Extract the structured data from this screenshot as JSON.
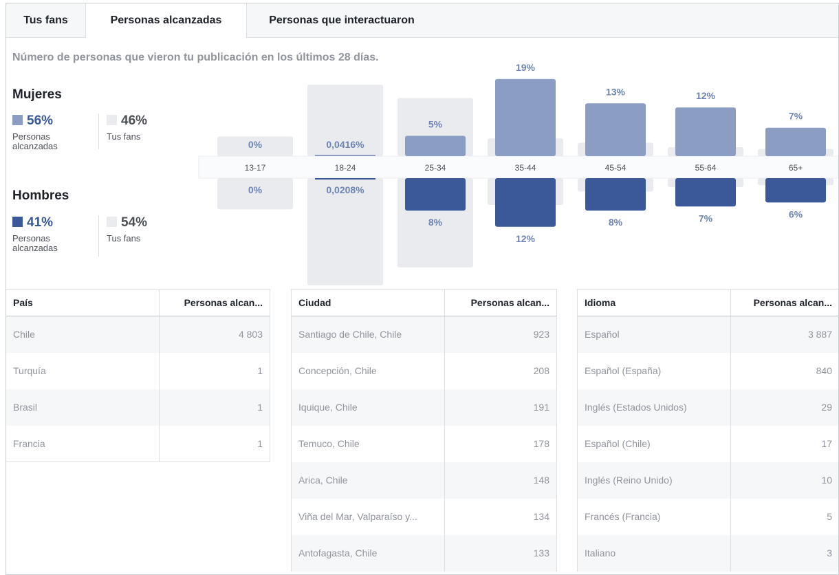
{
  "tabs": [
    "Tus fans",
    "Personas alcanzadas",
    "Personas que interactuaron"
  ],
  "subtitle": "Número de personas que vieron tu publicación en los últimos 28 días.",
  "women": {
    "title": "Mujeres",
    "reached_pct": "56%",
    "reached_label": "Personas alcanzadas",
    "fans_pct": "46%",
    "fans_label": "Tus fans"
  },
  "men": {
    "title": "Hombres",
    "reached_pct": "41%",
    "reached_label": "Personas alcanzadas",
    "fans_pct": "54%",
    "fans_label": "Tus fans"
  },
  "colors": {
    "women": "#8b9dc3",
    "men": "#3b5998",
    "fans": "#e9ebee",
    "axis_band": "#f6f7f9"
  },
  "chart_data": {
    "type": "bar",
    "categories": [
      "13-17",
      "18-24",
      "25-34",
      "35-44",
      "45-54",
      "55-64",
      "65+"
    ],
    "series": [
      {
        "name": "Mujeres",
        "values": [
          0,
          0.0416,
          5,
          19,
          13,
          12,
          7
        ],
        "labels": [
          "0%",
          "0,0416%",
          "5%",
          "19%",
          "13%",
          "12%",
          "7%"
        ]
      },
      {
        "name": "Hombres",
        "values": [
          0,
          0.0208,
          8,
          12,
          8,
          7,
          6
        ],
        "labels": [
          "0%",
          "0,0208%",
          "8%",
          "12%",
          "8%",
          "7%",
          "6%"
        ]
      }
    ],
    "fans_women": [
      2.2,
      8,
      6.5,
      2,
      1.5,
      1,
      0.8
    ],
    "fans_men": [
      3.5,
      12,
      10,
      3,
      1.5,
      1,
      0.8
    ]
  },
  "tables": [
    {
      "headers": [
        "País",
        "Personas alcan..."
      ],
      "rows": [
        [
          "Chile",
          "4 803"
        ],
        [
          "Turquía",
          "1"
        ],
        [
          "Brasil",
          "1"
        ],
        [
          "Francia",
          "1"
        ]
      ]
    },
    {
      "headers": [
        "Ciudad",
        "Personas alcan..."
      ],
      "rows": [
        [
          "Santiago de Chile, Chile",
          "923"
        ],
        [
          "Concepción, Chile",
          "208"
        ],
        [
          "Iquique, Chile",
          "191"
        ],
        [
          "Temuco, Chile",
          "178"
        ],
        [
          "Arica, Chile",
          "148"
        ],
        [
          "Viña del Mar, Valparaíso y...",
          "134"
        ],
        [
          "Antofagasta, Chile",
          "133"
        ]
      ]
    },
    {
      "headers": [
        "Idioma",
        "Personas alcan..."
      ],
      "rows": [
        [
          "Español",
          "3 887"
        ],
        [
          "Español (España)",
          "840"
        ],
        [
          "Inglés (Estados Unidos)",
          "29"
        ],
        [
          "Español (Chile)",
          "17"
        ],
        [
          "Inglés (Reino Unido)",
          "10"
        ],
        [
          "Francés (Francia)",
          "5"
        ],
        [
          "Italiano",
          "3"
        ]
      ]
    }
  ]
}
